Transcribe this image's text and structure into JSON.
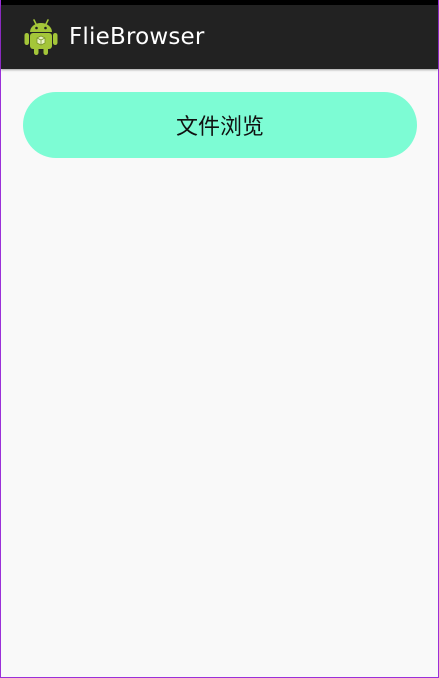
{
  "app": {
    "title": "FlieBrowser",
    "icon": "android-robot-icon"
  },
  "main": {
    "browse_button_label": "文件浏览"
  },
  "colors": {
    "action_bar": "#222222",
    "button": "#7dfcd4",
    "background": "#f9f9f9"
  }
}
